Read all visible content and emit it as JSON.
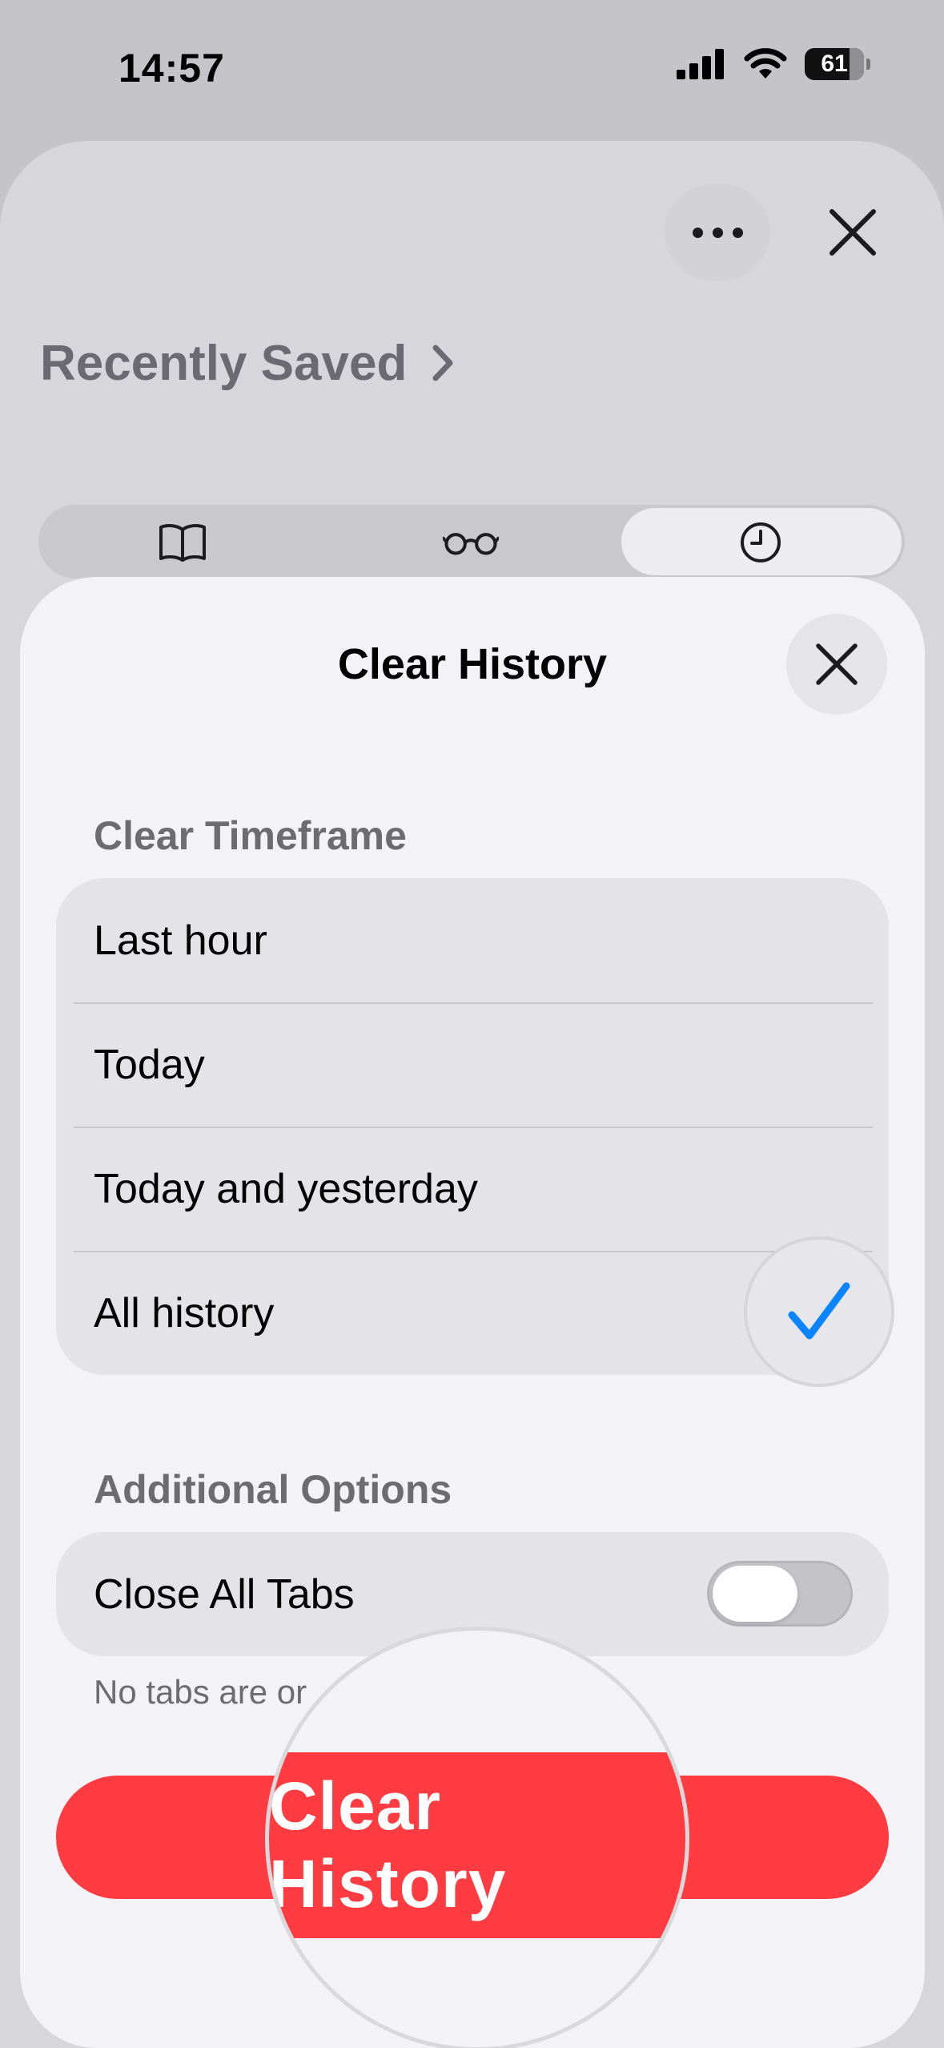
{
  "status_bar": {
    "time": "14:57",
    "battery": "61"
  },
  "background": {
    "title": "Recently Saved",
    "segments": [
      {
        "icon": "book-icon"
      },
      {
        "icon": "glasses-icon"
      },
      {
        "icon": "clock-icon",
        "selected": true
      }
    ]
  },
  "modal": {
    "title": "Clear History",
    "timeframe_header": "Clear Timeframe",
    "timeframe_options": [
      {
        "label": "Last hour",
        "selected": false
      },
      {
        "label": "Today",
        "selected": false
      },
      {
        "label": "Today and yesterday",
        "selected": false
      },
      {
        "label": "All history",
        "selected": true
      }
    ],
    "additional_header": "Additional Options",
    "close_all_tabs_label": "Close All Tabs",
    "close_all_tabs_on": false,
    "footnote": "No tabs are or",
    "clear_button_label": "Clear History"
  },
  "colors": {
    "accent": "#0a84ff",
    "destructive": "#ff3b42"
  }
}
